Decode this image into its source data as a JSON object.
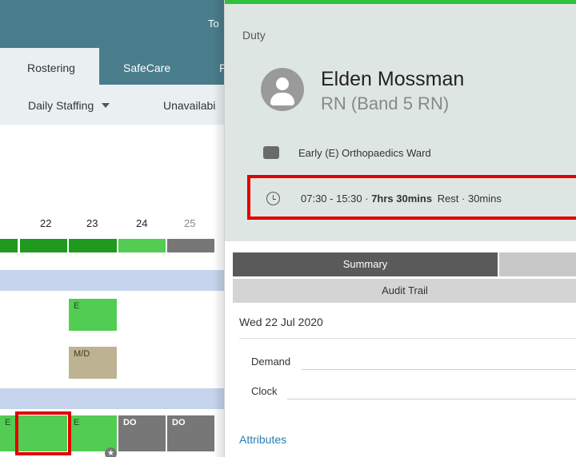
{
  "app": {
    "topbar_text": "To",
    "tabs": [
      {
        "label": "Rostering",
        "active": true
      },
      {
        "label": "SafeCare",
        "active": false
      },
      {
        "label": "F",
        "active": false
      }
    ],
    "subnav": {
      "daily_staffing": "Daily Staffing",
      "unavailability": "Unavailabi"
    },
    "days": [
      "22",
      "23",
      "24",
      "25"
    ],
    "shifts": {
      "row1_e": "E",
      "row2_md": "M/D",
      "row3_e1": "E",
      "row3_e2": "E",
      "row3_do1": "DO",
      "row3_do2": "DO"
    },
    "colors": {
      "header": "#4a7d8c",
      "shift_early": "#52cc52",
      "shift_md": "#bdb392",
      "shift_do": "#777777",
      "band": "#c5d4ec",
      "highlight": "#e00000"
    }
  },
  "panel": {
    "title": "Duty",
    "staff": {
      "name": "Elden Mossman",
      "grade": "RN (Band 5 RN)"
    },
    "ward": "Early (E) Orthopaedics Ward",
    "time": {
      "range": "07:30 - 15:30 ·",
      "hours": "7hrs 30mins",
      "rest": "Rest · 30mins"
    },
    "tabs": {
      "summary": "Summary",
      "audit_trail": "Audit Trail"
    },
    "date": "Wed 22 Jul 2020",
    "fields": {
      "demand": "Demand",
      "clock": "Clock"
    },
    "attributes_label": "Attributes",
    "accent": "#2fc23a"
  }
}
